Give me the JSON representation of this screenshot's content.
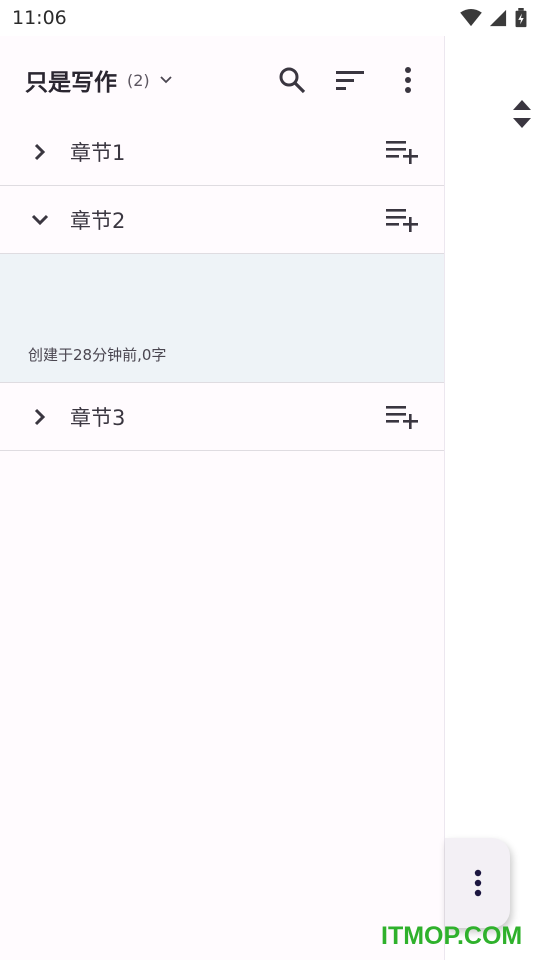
{
  "status_bar": {
    "time": "11:06"
  },
  "header": {
    "title": "只是写作",
    "count": "(2)",
    "icons": [
      "chevron-down-icon",
      "search-icon",
      "sort-icon",
      "more-vert-icon"
    ]
  },
  "chapters": [
    {
      "label": "章节1",
      "expanded": false
    },
    {
      "label": "章节2",
      "expanded": true
    },
    {
      "label": "章节3",
      "expanded": false
    }
  ],
  "chapter2_doc": {
    "meta": "创建于28分钟前,0字"
  },
  "fab": {
    "icon": "more-vert-icon"
  },
  "watermark": "ITMOP.COM",
  "colors": {
    "panel_bg": "#fffbfe",
    "doc_bg": "#eef3f7",
    "watermark": "#2fb12c"
  }
}
